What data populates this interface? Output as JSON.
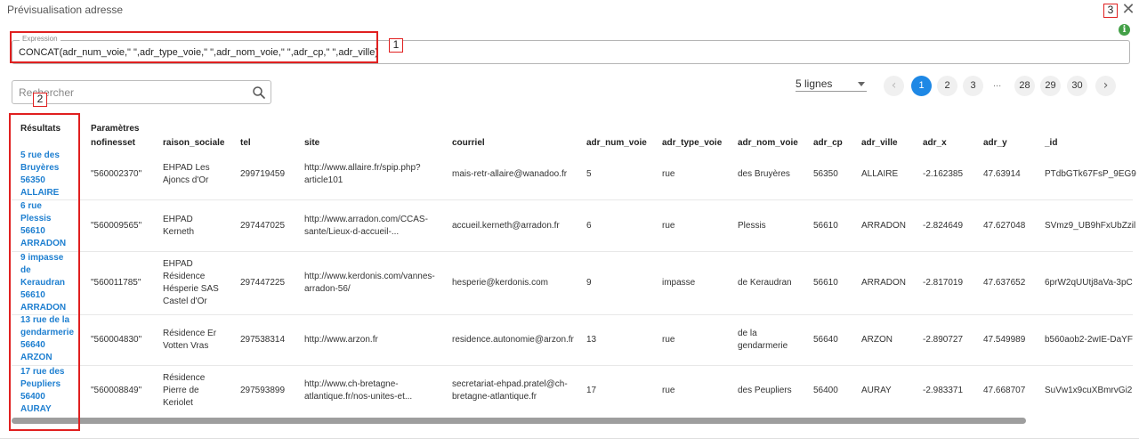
{
  "dialog": {
    "title": "Prévisualisation adresse",
    "close_glyph": "✕",
    "info_glyph": "i"
  },
  "expression": {
    "legend": "Expression",
    "value": "CONCAT(adr_num_voie,\" \",adr_type_voie,\" \",adr_nom_voie,\" \",adr_cp,\" \",adr_ville)"
  },
  "search": {
    "placeholder": "Rechercher",
    "icon": "search-icon"
  },
  "pagination": {
    "lines_label": "5 lignes",
    "prev": "‹",
    "next": "›",
    "pages_start": [
      "1",
      "2",
      "3"
    ],
    "ellipsis": "...",
    "pages_end": [
      "28",
      "29",
      "30"
    ],
    "active_page": "1"
  },
  "annotations": [
    "1",
    "2",
    "3"
  ],
  "table": {
    "group_header": "Paramètres",
    "results_header": "Résultats",
    "columns": [
      "nofinesset",
      "raison_sociale",
      "tel",
      "site",
      "courriel",
      "adr_num_voie",
      "adr_type_voie",
      "adr_nom_voie",
      "adr_cp",
      "adr_ville",
      "adr_x",
      "adr_y",
      "_id"
    ],
    "rows": [
      {
        "result": [
          "5 rue des",
          "Bruyères",
          "56350",
          "ALLAIRE"
        ],
        "nofinesset": "\"560002370\"",
        "raison_sociale": [
          "EHPAD Les",
          "Ajoncs d'Or"
        ],
        "tel": "299719459",
        "site": [
          "http://www.allaire.fr/spip.php?",
          "article101"
        ],
        "courriel": "mais-retr-allaire@wanadoo.fr",
        "adr_num_voie": "5",
        "adr_type_voie": "rue",
        "adr_nom_voie": [
          "des Bruyères"
        ],
        "adr_cp": "56350",
        "adr_ville": "ALLAIRE",
        "adr_x": "-2.162385",
        "adr_y": "47.63914",
        "_id": "PTdbGTk67FsP_9EG9"
      },
      {
        "result": [
          "6 rue",
          "Plessis",
          "56610",
          "ARRADON"
        ],
        "nofinesset": "\"560009565\"",
        "raison_sociale": [
          "EHPAD",
          "Kerneth"
        ],
        "tel": "297447025",
        "site": [
          "http://www.arradon.com/CCAS-",
          "sante/Lieux-d-accueil-..."
        ],
        "courriel": "accueil.kerneth@arradon.fr",
        "adr_num_voie": "6",
        "adr_type_voie": "rue",
        "adr_nom_voie": [
          "Plessis"
        ],
        "adr_cp": "56610",
        "adr_ville": "ARRADON",
        "adr_x": "-2.824649",
        "adr_y": "47.627048",
        "_id": "SVmz9_UB9hFxUbZzil"
      },
      {
        "result": [
          "9 impasse",
          "de",
          "Keraudran",
          "56610",
          "ARRADON"
        ],
        "nofinesset": "\"560011785\"",
        "raison_sociale": [
          "EHPAD",
          "Résidence",
          "Hésperie SAS",
          "Castel d'Or"
        ],
        "tel": "297447225",
        "site": [
          "http://www.kerdonis.com/vannes-",
          "arradon-56/"
        ],
        "courriel": "hesperie@kerdonis.com",
        "adr_num_voie": "9",
        "adr_type_voie": "impasse",
        "adr_nom_voie": [
          "de Keraudran"
        ],
        "adr_cp": "56610",
        "adr_ville": "ARRADON",
        "adr_x": "-2.817019",
        "adr_y": "47.637652",
        "_id": "6prW2qUUtj8aVa-3pC"
      },
      {
        "result": [
          "13 rue de la",
          "gendarmerie",
          "56640",
          "ARZON"
        ],
        "nofinesset": "\"560004830\"",
        "raison_sociale": [
          "Résidence Er",
          "Votten Vras"
        ],
        "tel": "297538314",
        "site": [
          "http://www.arzon.fr"
        ],
        "courriel": "residence.autonomie@arzon.fr",
        "adr_num_voie": "13",
        "adr_type_voie": "rue",
        "adr_nom_voie": [
          "de la",
          "gendarmerie"
        ],
        "adr_cp": "56640",
        "adr_ville": "ARZON",
        "adr_x": "-2.890727",
        "adr_y": "47.549989",
        "_id": "b560aob2-2wIE-DaYF"
      },
      {
        "result": [
          "17 rue des",
          "Peupliers",
          "56400",
          "AURAY"
        ],
        "nofinesset": "\"560008849\"",
        "raison_sociale": [
          "Résidence",
          "Pierre de",
          "Keriolet"
        ],
        "tel": "297593899",
        "site": [
          "http://www.ch-bretagne-",
          "atlantique.fr/nos-unites-et..."
        ],
        "courriel": [
          "secretariat-ehpad.pratel@ch-",
          "bretagne-atlantique.fr"
        ],
        "adr_num_voie": "17",
        "adr_type_voie": "rue",
        "adr_nom_voie": [
          "des Peupliers"
        ],
        "adr_cp": "56400",
        "adr_ville": "AURAY",
        "adr_x": "-2.983371",
        "adr_y": "47.668707",
        "_id": "SuVw1x9cuXBmrvGi2"
      }
    ]
  },
  "colors": {
    "accent": "#1e88e5",
    "link": "#1e7fd0",
    "annotation": "#e02020",
    "info": "#43a047"
  }
}
